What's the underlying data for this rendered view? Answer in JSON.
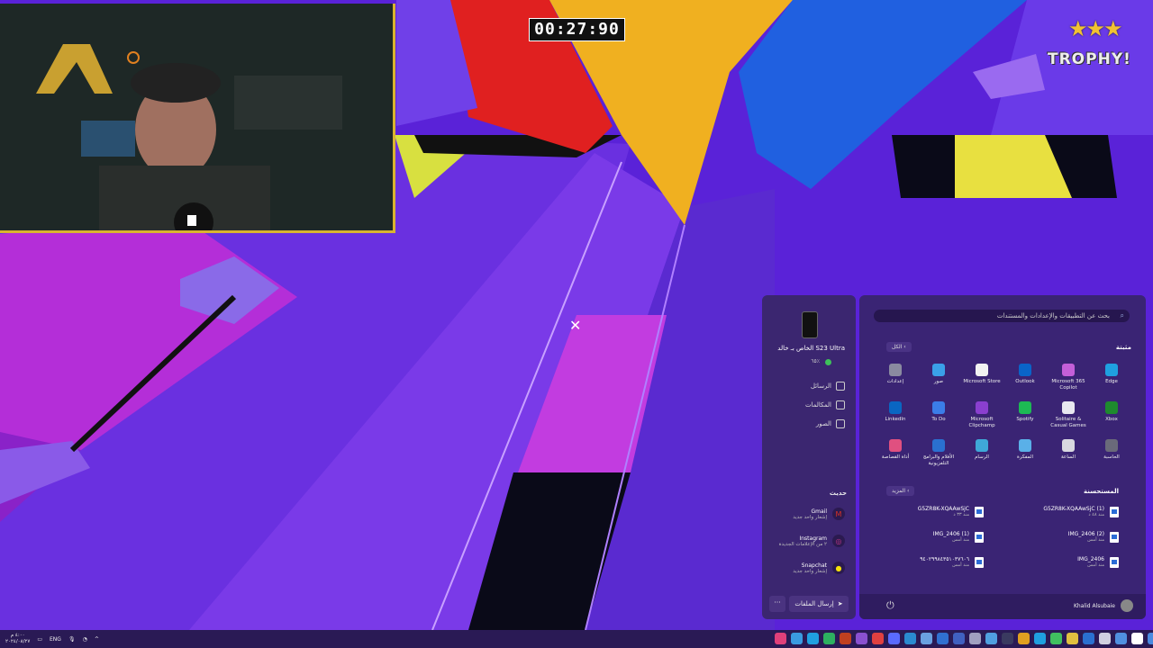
{
  "game": {
    "timer": "00:27:90",
    "stars": "★★★",
    "trophy_label": "TROPHY!"
  },
  "phone": {
    "device_name": "الخاص بـ خالد S23 Ultra",
    "status": "٦٥٪",
    "items": [
      {
        "label": "الرسائل",
        "icon": "message-icon"
      },
      {
        "label": "المكالمات",
        "icon": "phone-icon"
      },
      {
        "label": "الصور",
        "icon": "photo-icon"
      }
    ],
    "recent_title": "حديث",
    "notifications": [
      {
        "app": "Gmail",
        "desc": "إشعار واحد جديد",
        "color": "#d93025",
        "glyph": "M"
      },
      {
        "app": "Instagram",
        "desc": "٢ من الإعلامات الجديدة",
        "color": "#c13584",
        "glyph": "◎"
      },
      {
        "app": "Snapchat",
        "desc": "إشعار واحد جديد",
        "color": "#f7e20b",
        "glyph": "●"
      }
    ],
    "send_label": "إرسال الملفات",
    "more_label": "···"
  },
  "start": {
    "search_placeholder": "بحث عن التطبيقات والإعدادات والمستندات",
    "pinned_title": "مثبتة",
    "all_label": "الكل",
    "pinned_apps": [
      {
        "label": "Edge",
        "color": "#1fa0e0"
      },
      {
        "label": "Microsoft 365 Copilot",
        "color": "#c45fd8"
      },
      {
        "label": "Outlook",
        "color": "#0a64c8"
      },
      {
        "label": "Microsoft Store",
        "color": "#f2f2f2"
      },
      {
        "label": "صور",
        "color": "#3aa0e8"
      },
      {
        "label": "إعدادات",
        "color": "#8a8aa0"
      },
      {
        "label": "Xbox",
        "color": "#1e8a2e"
      },
      {
        "label": "Solitaire & Casual Games",
        "color": "#e8e8f0"
      },
      {
        "label": "Spotify",
        "color": "#1db954"
      },
      {
        "label": "Microsoft Clipchamp",
        "color": "#8a3fcf"
      },
      {
        "label": "To Do",
        "color": "#3b7de8"
      },
      {
        "label": "LinkedIn",
        "color": "#0a66c2"
      },
      {
        "label": "الحاسبة",
        "color": "#6a6a7a"
      },
      {
        "label": "الساعة",
        "color": "#d8d8e0"
      },
      {
        "label": "المفكرة",
        "color": "#5ab0e8"
      },
      {
        "label": "الرسام",
        "color": "#3fa8d8"
      },
      {
        "label": "الأفلام والبرامج التلفزيونية",
        "color": "#2a70d0"
      },
      {
        "label": "أداة القصاصة",
        "color": "#e05080"
      }
    ],
    "recommended_title": "المستحسنة",
    "more_label": "المزيد",
    "recommended": [
      {
        "name": "G5ZR8K-XQAAwSjC (1)",
        "time": "منذ ٤٨ د"
      },
      {
        "name": "G5ZR8K-XQAAwSjC",
        "time": "منذ ٣٣ د"
      },
      {
        "name": "IMG_2406 (2)",
        "time": "منذ أمس"
      },
      {
        "name": "IMG_2406 (1)",
        "time": "منذ أمس"
      },
      {
        "name": "IMG_2406",
        "time": "منذ أمس"
      },
      {
        "name": "٩٤٠٢٩٩٨٤٣٥١٠٣٧٦٠٦",
        "time": "منذ أمس"
      }
    ],
    "user_name": "Khalid Alsubaie",
    "power_icon": "power-icon"
  },
  "taskbar": {
    "time": "٤:٠٠ م",
    "date": "٢٠٢٤/٠٨/٢٧",
    "lang": "ENG",
    "app_colors": [
      "#e0407a",
      "#3a9ae0",
      "#1fa0e0",
      "#2db060",
      "#c04020",
      "#8a50d0",
      "#e04040",
      "#5a6aff",
      "#2a8ad0",
      "#6aa0e0",
      "#3070d0",
      "#4060c0",
      "#a0a0c0",
      "#50a0e0",
      "#3a3a60",
      "#e0a020",
      "#1fa0e0",
      "#40c060",
      "#e0c040",
      "#2a70d0",
      "#d0d0e0",
      "#5090e0",
      "#ffffff",
      "#4a8ae0"
    ]
  }
}
